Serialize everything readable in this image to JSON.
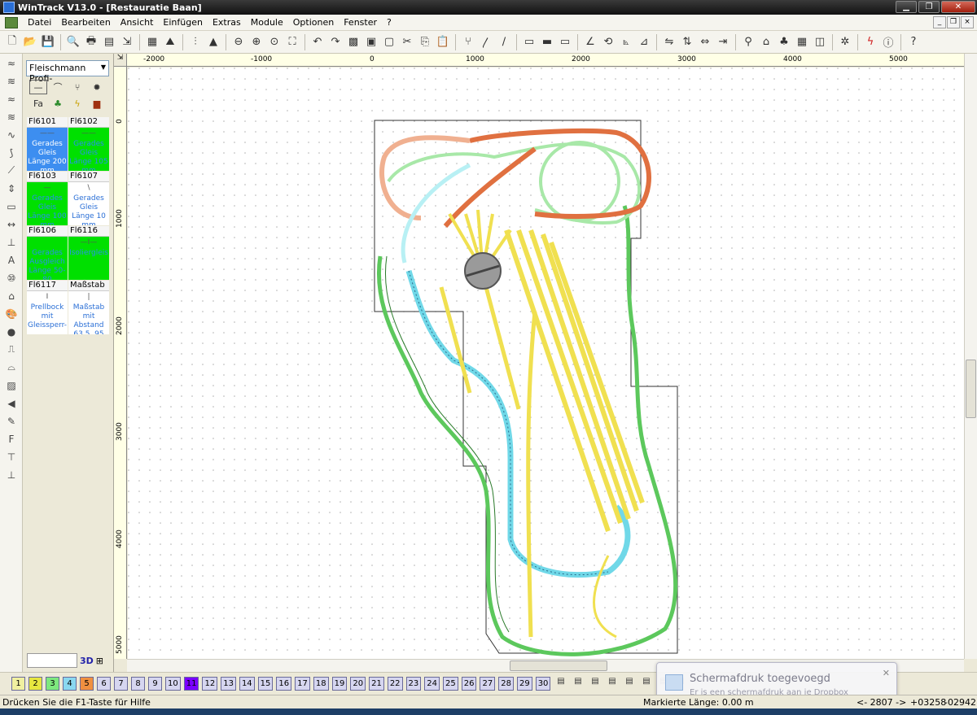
{
  "window": {
    "title": "WinTrack  V13.0 - [Restauratie Baan]"
  },
  "menu": [
    "Datei",
    "Bearbeiten",
    "Ansicht",
    "Einfügen",
    "Extras",
    "Module",
    "Optionen",
    "Fenster",
    "?"
  ],
  "library": {
    "selected": "Fleischmann Profi-",
    "tiles": [
      {
        "code": "Fl6101",
        "glyph": "——",
        "desc": "Gerades Gleis Länge 200 mm",
        "style": "blue"
      },
      {
        "code": "Fl6102",
        "glyph": "——",
        "desc": "Gerades Gleis Länge 105 mm",
        "style": "green"
      },
      {
        "code": "Fl6103",
        "glyph": "—",
        "desc": "Gerades Gleis Länge 100 mm",
        "style": "green"
      },
      {
        "code": "Fl6107",
        "glyph": "\\",
        "desc": "Gerades Gleis Länge 10 mm",
        "style": "white"
      },
      {
        "code": "Fl6106",
        "glyph": "",
        "desc": "Gerades Ausgleich Länge 50-80",
        "style": "green"
      },
      {
        "code": "Fl6116",
        "glyph": "—I—",
        "desc": "Isoliergleis",
        "style": "green"
      },
      {
        "code": "Fl6117",
        "glyph": "I",
        "desc": "Prellbock mit Gleissperr-",
        "style": "white"
      },
      {
        "code": "Maßstab",
        "glyph": "|",
        "desc": "Maßstab mit Abstand 63.5, 95",
        "style": "white"
      }
    ],
    "view3d_label": "3D"
  },
  "rulers": {
    "h_labels": [
      "-2000",
      "-1000",
      "0",
      "1000",
      "2000",
      "3000",
      "4000",
      "5000"
    ],
    "v_labels": [
      "0",
      "1000",
      "2000",
      "3000",
      "4000",
      "5000"
    ]
  },
  "layers": [
    "1",
    "2",
    "3",
    "4",
    "5",
    "6",
    "7",
    "8",
    "9",
    "10",
    "11",
    "12",
    "13",
    "14",
    "15",
    "16",
    "17",
    "18",
    "19",
    "20",
    "21",
    "22",
    "23",
    "24",
    "25",
    "26",
    "27",
    "28",
    "29",
    "30"
  ],
  "layer_colors": {
    "1": "#f0f0a0",
    "2": "#e6e640",
    "3": "#7ee87e",
    "4": "#8ad8f0",
    "5": "#f09040",
    "11": "#7a00ff"
  },
  "notification": {
    "title": "Schermafdruk toegevoegd",
    "body": "Er is een schermafdruk aan je Dropbox toegevoegd."
  },
  "status": {
    "help": "Drücken Sie die  F1-Taste für Hilfe",
    "marked_length": "Markierte Länge: 0.00 m",
    "scale": "<- 2807 ->",
    "x": "+03258",
    "y": "-02942"
  },
  "track_colors": {
    "green": "#5cc85c",
    "lightgreen": "#a8e8a8",
    "yellow": "#f0e050",
    "orange": "#e07040",
    "salmon": "#f0b090",
    "cyan": "#70d8e8",
    "lightcyan": "#b8f0f4"
  }
}
